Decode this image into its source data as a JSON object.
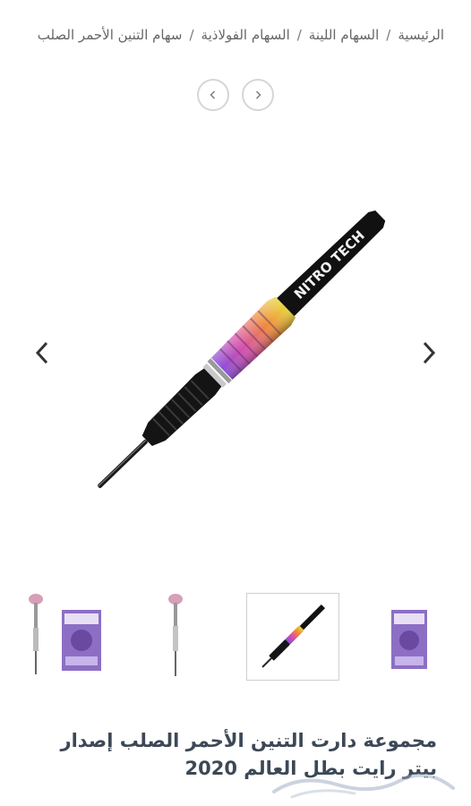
{
  "breadcrumb": {
    "items": [
      "الرئيسية",
      "السهام اللينة",
      "السهام الفولاذية",
      "سهام  التنين الأحمر الصلب"
    ],
    "separator": "/"
  },
  "pager": {
    "prev_icon": "chevron-left-icon",
    "next_icon": "chevron-right-icon"
  },
  "gallery": {
    "logo_text": "NITRO TECH",
    "thumbnails": [
      "dart-packaging",
      "dart-upright",
      "dart-diagonal",
      "dart-packaging"
    ],
    "active_index": 2
  },
  "product": {
    "title": "مجموعة دارت التنين الأحمر الصلب إصدار بيتر رايت بطل العالم 2020"
  },
  "colors": {
    "title": "#3c4856",
    "text": "#666666",
    "border": "#d6d6d6"
  }
}
